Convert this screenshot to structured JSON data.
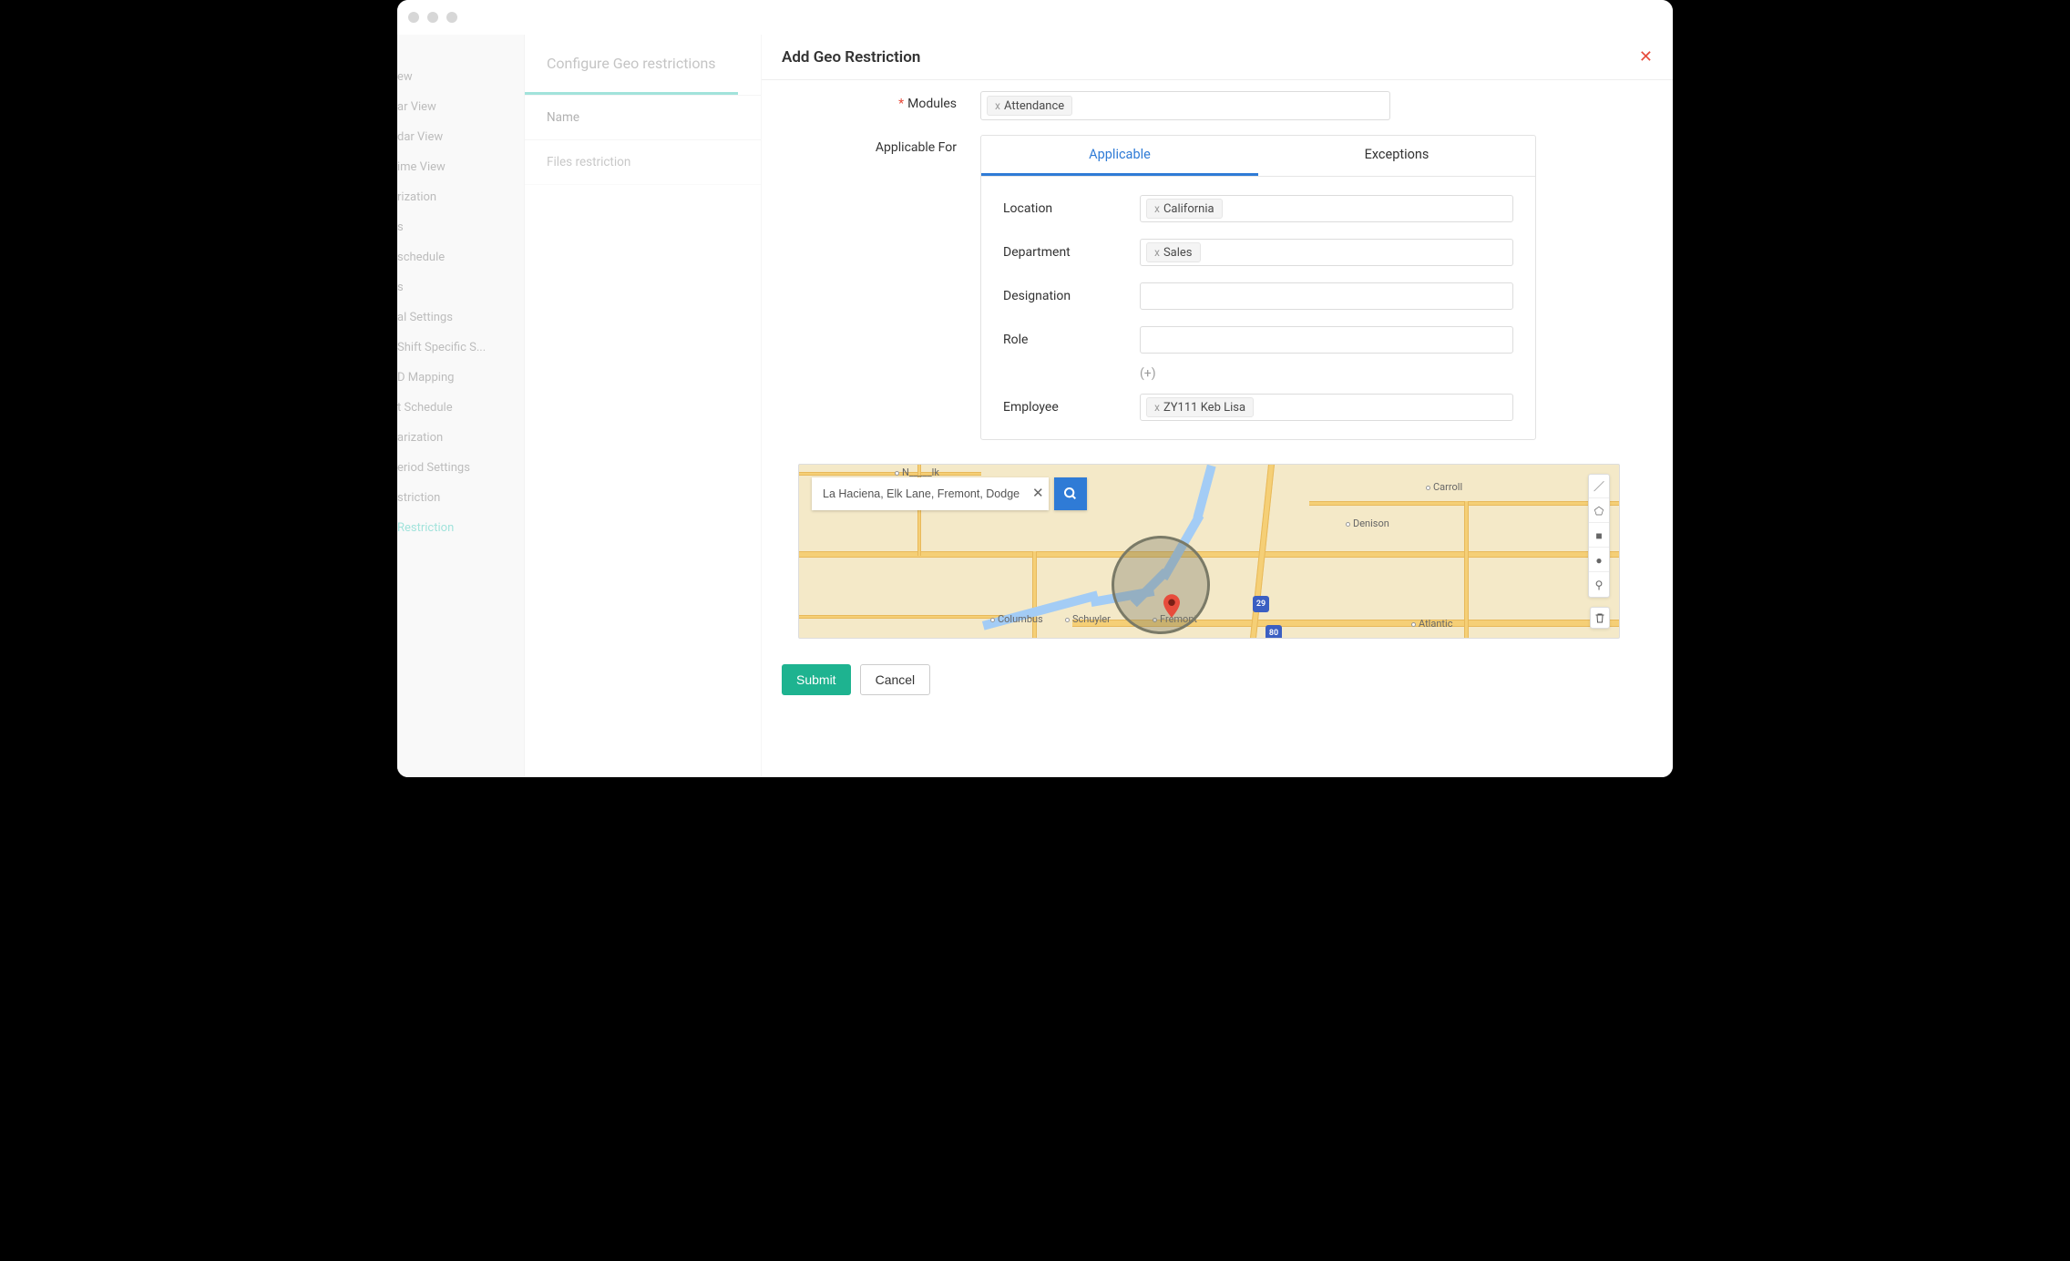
{
  "sidebar": {
    "items": [
      "ew",
      "ar View",
      "dar View",
      "ime View",
      "rization",
      "s",
      "schedule",
      "s",
      "al Settings",
      "Shift Specific S...",
      "D Mapping",
      "t Schedule",
      "arization",
      "eriod Settings",
      "striction",
      "Restriction"
    ],
    "activeIndex": 15
  },
  "midpanel": {
    "title": "Configure Geo restrictions",
    "header": "Name",
    "row": "Files restriction"
  },
  "modal": {
    "title": "Add Geo Restriction",
    "labels": {
      "modules": "Modules",
      "applicable_for": "Applicable For"
    },
    "modules_tag": "Attendance",
    "tabs": {
      "applicable": "Applicable",
      "exceptions": "Exceptions"
    },
    "fields": {
      "location_label": "Location",
      "location_value": "California",
      "department_label": "Department",
      "department_value": "Sales",
      "designation_label": "Designation",
      "role_label": "Role",
      "addmore": "(+)",
      "employee_label": "Employee",
      "employee_value": "ZY111 Keb Lisa"
    },
    "map": {
      "search_value": "La Haciena, Elk Lane, Fremont, Dodge County,",
      "cities": {
        "norfolk_partial": "N_____lk",
        "columbus": "Columbus",
        "schuyler": "Schuyler",
        "fremont": "Fremont",
        "carroll": "Carroll",
        "denison": "Denison",
        "atlantic": "Atlantic"
      },
      "shields": {
        "i29": "29",
        "i80": "80"
      }
    },
    "buttons": {
      "submit": "Submit",
      "cancel": "Cancel"
    }
  }
}
